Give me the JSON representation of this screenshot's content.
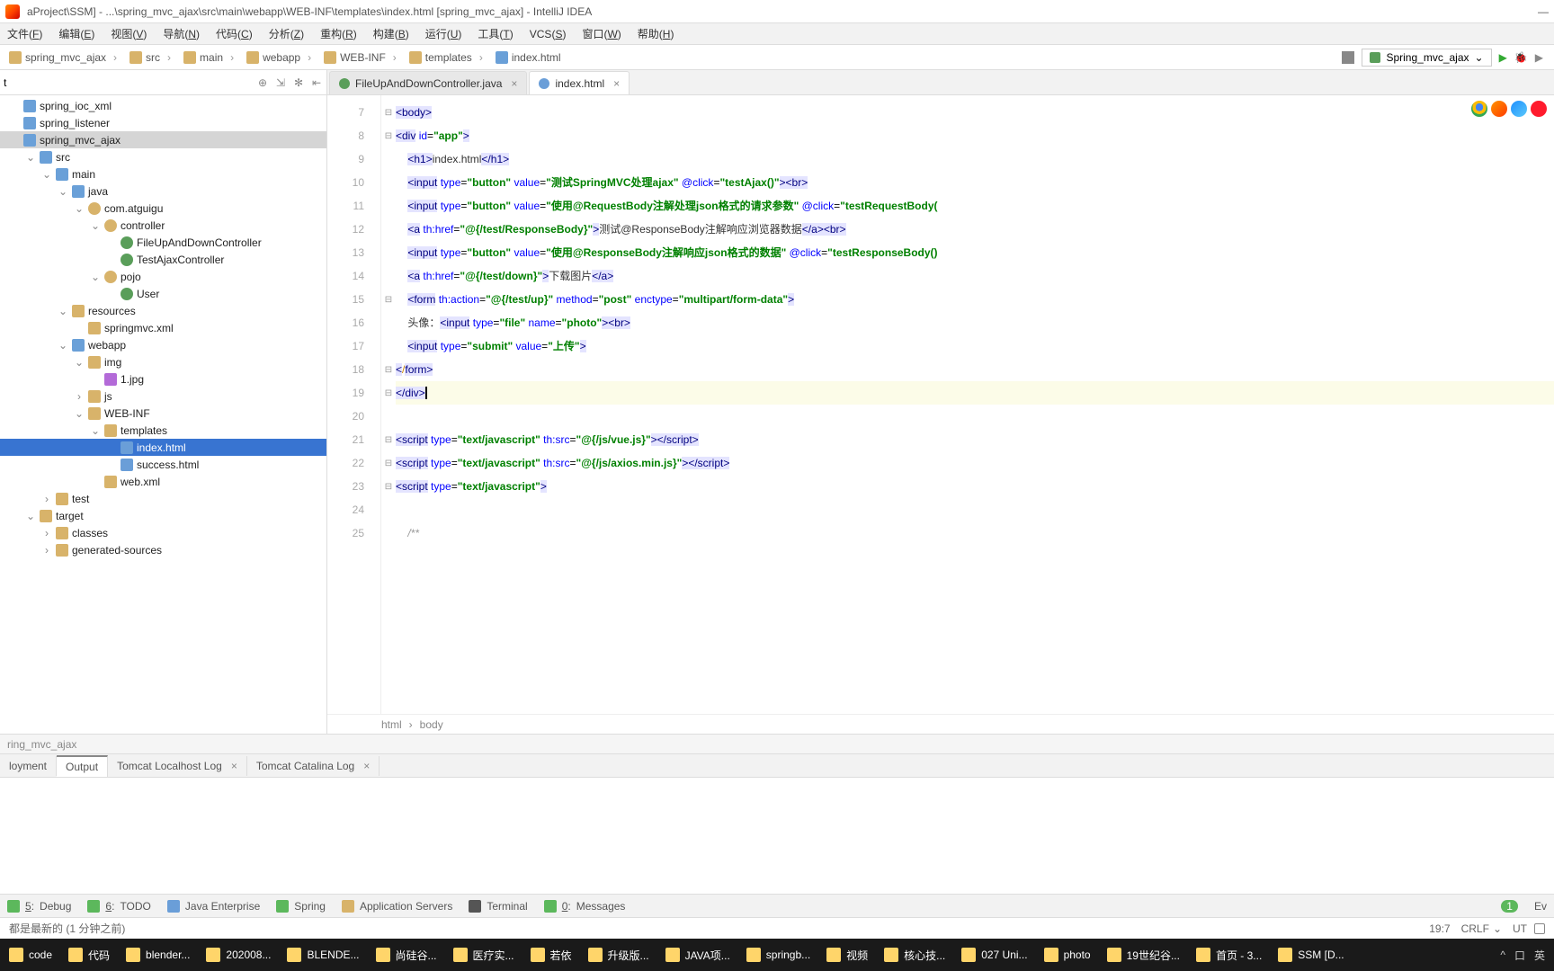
{
  "title": "aProject\\SSM] - ...\\spring_mvc_ajax\\src\\main\\webapp\\WEB-INF\\templates\\index.html [spring_mvc_ajax] - IntelliJ IDEA",
  "menu": [
    "文件(F)",
    "编辑(E)",
    "视图(V)",
    "导航(N)",
    "代码(C)",
    "分析(Z)",
    "重构(R)",
    "构建(B)",
    "运行(U)",
    "工具(T)",
    "VCS(S)",
    "窗口(W)",
    "帮助(H)"
  ],
  "crumbs": [
    "spring_mvc_ajax",
    "src",
    "main",
    "webapp",
    "WEB-INF",
    "templates",
    "index.html"
  ],
  "run_config": "Spring_mvc_ajax",
  "project_header": "t",
  "tree": [
    {
      "d": 0,
      "tw": "",
      "ic": "mod",
      "t": "spring_ioc_xml"
    },
    {
      "d": 0,
      "tw": "",
      "ic": "mod",
      "t": "spring_listener"
    },
    {
      "d": 0,
      "tw": "",
      "ic": "mod",
      "t": "spring_mvc_ajax",
      "sel": true
    },
    {
      "d": 1,
      "tw": "exp",
      "ic": "folderb",
      "t": "src"
    },
    {
      "d": 2,
      "tw": "exp",
      "ic": "folderb",
      "t": "main"
    },
    {
      "d": 3,
      "tw": "exp",
      "ic": "folderb",
      "t": "java"
    },
    {
      "d": 4,
      "tw": "exp",
      "ic": "pkg",
      "t": "com.atguigu"
    },
    {
      "d": 5,
      "tw": "exp",
      "ic": "pkg",
      "t": "controller"
    },
    {
      "d": 6,
      "tw": "",
      "ic": "cls",
      "t": "FileUpAndDownController"
    },
    {
      "d": 6,
      "tw": "",
      "ic": "cls",
      "t": "TestAjaxController"
    },
    {
      "d": 5,
      "tw": "exp",
      "ic": "pkg",
      "t": "pojo"
    },
    {
      "d": 6,
      "tw": "",
      "ic": "cls",
      "t": "User"
    },
    {
      "d": 3,
      "tw": "exp",
      "ic": "folder",
      "t": "resources"
    },
    {
      "d": 4,
      "tw": "",
      "ic": "xml",
      "t": "springmvc.xml"
    },
    {
      "d": 3,
      "tw": "exp",
      "ic": "folderb",
      "t": "webapp"
    },
    {
      "d": 4,
      "tw": "exp",
      "ic": "folder",
      "t": "img"
    },
    {
      "d": 5,
      "tw": "",
      "ic": "jpg",
      "t": "1.jpg"
    },
    {
      "d": 4,
      "tw": "col",
      "ic": "folder",
      "t": "js"
    },
    {
      "d": 4,
      "tw": "exp",
      "ic": "folder",
      "t": "WEB-INF"
    },
    {
      "d": 5,
      "tw": "exp",
      "ic": "folder",
      "t": "templates"
    },
    {
      "d": 6,
      "tw": "",
      "ic": "html",
      "t": "index.html",
      "self": true
    },
    {
      "d": 6,
      "tw": "",
      "ic": "html",
      "t": "success.html"
    },
    {
      "d": 5,
      "tw": "",
      "ic": "xml",
      "t": "web.xml"
    },
    {
      "d": 2,
      "tw": "col",
      "ic": "folder",
      "t": "test"
    },
    {
      "d": 1,
      "tw": "exp",
      "ic": "folder",
      "t": "target"
    },
    {
      "d": 2,
      "tw": "col",
      "ic": "folder",
      "t": "classes"
    },
    {
      "d": 2,
      "tw": "col",
      "ic": "folder",
      "t": "generated-sources"
    }
  ],
  "tabs": [
    {
      "label": "FileUpAndDownController.java",
      "ic": "j",
      "active": false,
      "close": true
    },
    {
      "label": "index.html",
      "ic": "h",
      "active": true,
      "close": true
    }
  ],
  "code": {
    "start": 7,
    "lines": [
      {
        "n": 7,
        "html": "<span class='tagb'>&lt;body&gt;</span>"
      },
      {
        "n": 8,
        "html": "<span class='tagb'>&lt;div</span> <span class='attr'>id</span>=<span class='val'>\"app\"</span><span class='tagb'>&gt;</span>"
      },
      {
        "n": 9,
        "html": "    <span class='tagb'>&lt;h1&gt;</span><span class='txt'>index.html</span><span class='tagb'>&lt;/h1&gt;</span>"
      },
      {
        "n": 10,
        "html": "    <span class='tagb'>&lt;input</span> <span class='attr'>type</span>=<span class='val'>\"button\"</span> <span class='attr'>value</span>=<span class='val'>\"测试SpringMVC处理ajax\"</span> <span class='attr'>@click</span>=<span class='val'>\"testAjax()\"</span><span class='tagb'>&gt;&lt;br&gt;</span>"
      },
      {
        "n": 11,
        "html": "    <span class='tagb'>&lt;input</span> <span class='attr'>type</span>=<span class='val'>\"button\"</span> <span class='attr'>value</span>=<span class='val'>\"使用@RequestBody注解处理json格式的请求参数\"</span> <span class='attr'>@click</span>=<span class='val'>\"testRequestBody(</span>"
      },
      {
        "n": 12,
        "html": "    <span class='tagb'>&lt;a</span> <span class='attr'>th:href</span>=<span class='val'>\"@{/test/ResponseBody}\"</span><span class='tagb'>&gt;</span><span class='txt'>测试@ResponseBody注解响应浏览器数据</span><span class='tagb'>&lt;/a&gt;&lt;br&gt;</span>"
      },
      {
        "n": 13,
        "html": "    <span class='tagb'>&lt;input</span> <span class='attr'>type</span>=<span class='val'>\"button\"</span> <span class='attr'>value</span>=<span class='val'>\"使用@ResponseBody注解响应json格式的数据\"</span> <span class='attr'>@click</span>=<span class='val'>\"testResponseBody()</span>"
      },
      {
        "n": 14,
        "html": "    <span class='tagb'>&lt;a</span> <span class='attr'>th:href</span>=<span class='val'>\"@{/test/down}\"</span><span class='tagb'>&gt;</span><span class='txt'>下载图片</span><span class='tagb'>&lt;/a&gt;</span>"
      },
      {
        "n": 15,
        "html": "    <span class='tagb'>&lt;form</span> <span class='attr'>th:action</span>=<span class='val'>\"@{/test/up}\"</span> <span class='attr'>method</span>=<span class='val'>\"post\"</span> <span class='attr'>enctype</span>=<span class='val'>\"multipart/form-data\"</span><span class='tagb'>&gt;</span>"
      },
      {
        "n": 16,
        "html": "    <span class='txt'>头像：</span><span class='tagb'>&lt;input</span> <span class='attr'>type</span>=<span class='val'>\"file\"</span> <span class='attr'>name</span>=<span class='val'>\"photo\"</span><span class='tagb'>&gt;&lt;br&gt;</span>"
      },
      {
        "n": 17,
        "html": "    <span class='tagb'>&lt;input</span> <span class='attr'>type</span>=<span class='val'>\"submit\"</span> <span class='attr'>value</span>=<span class='val'>\"上传\"</span><span class='tagb'>&gt;</span>"
      },
      {
        "n": 18,
        "html": "<span class='tagb'>&lt;</span><span class='tagn' style='color:#c80'>/</span><span class='tagb'>form&gt;</span>"
      },
      {
        "n": 19,
        "hl": true,
        "html": "<span class='tagb'>&lt;/div&gt;</span><span class='caret'></span>"
      },
      {
        "n": 20,
        "html": ""
      },
      {
        "n": 21,
        "html": "<span class='tagb'>&lt;script</span> <span class='attr'>type</span>=<span class='val'>\"text/javascript\"</span> <span class='attr'>th:src</span>=<span class='val'>\"@{/js/vue.js}\"</span><span class='tagb'>&gt;&lt;/script&gt;</span>"
      },
      {
        "n": 22,
        "html": "<span class='tagb'>&lt;script</span> <span class='attr'>type</span>=<span class='val'>\"text/javascript\"</span> <span class='attr'>th:src</span>=<span class='val'>\"@{/js/axios.min.js}\"</span><span class='tagb'>&gt;&lt;/script&gt;</span>"
      },
      {
        "n": 23,
        "html": "<span class='tagb'>&lt;script</span> <span class='attr'>type</span>=<span class='val'>\"text/javascript\"</span><span class='tagb'>&gt;</span>"
      },
      {
        "n": 24,
        "html": ""
      },
      {
        "n": 25,
        "html": "    <span style='color:#999;font-style:italic'>/**</span>"
      }
    ]
  },
  "breadcrumb": [
    "html",
    "body"
  ],
  "lowbar": "ring_mvc_ajax",
  "logtabs": [
    {
      "t": "loyment"
    },
    {
      "t": "Output",
      "active": true
    },
    {
      "t": "Tomcat Localhost Log",
      "close": true
    },
    {
      "t": "Tomcat Catalina Log",
      "close": true
    }
  ],
  "bottombar": [
    {
      "n": "5",
      "t": "Debug",
      "c": "#5cb85c"
    },
    {
      "n": "6",
      "t": "TODO",
      "c": "#5cb85c"
    },
    {
      "t": "Java Enterprise",
      "c": "#6a9ed8"
    },
    {
      "t": "Spring",
      "c": "#5cb85c"
    },
    {
      "t": "Application Servers",
      "c": "#d8b36a"
    },
    {
      "t": "Terminal",
      "c": "#555"
    },
    {
      "n": "0",
      "t": "Messages",
      "c": "#5cb85c"
    }
  ],
  "event_count": "1",
  "event_label": "Ev",
  "status_left": "都是最新的 (1 分钟之前)",
  "status_right": {
    "pos": "19:7",
    "enc": "CRLF",
    "sep": "UT"
  },
  "taskbar": [
    "code",
    "代码",
    "blender...",
    "202008...",
    "BLENDE...",
    "尚硅谷...",
    "医疗实...",
    "若依",
    "升级版...",
    "JAVA项...",
    "springb...",
    "视频",
    "核心技...",
    "027 Uni...",
    "photo",
    "19世纪谷...",
    "首页 - 3...",
    "SSM [D..."
  ],
  "tray": [
    "^",
    "口",
    "英"
  ]
}
